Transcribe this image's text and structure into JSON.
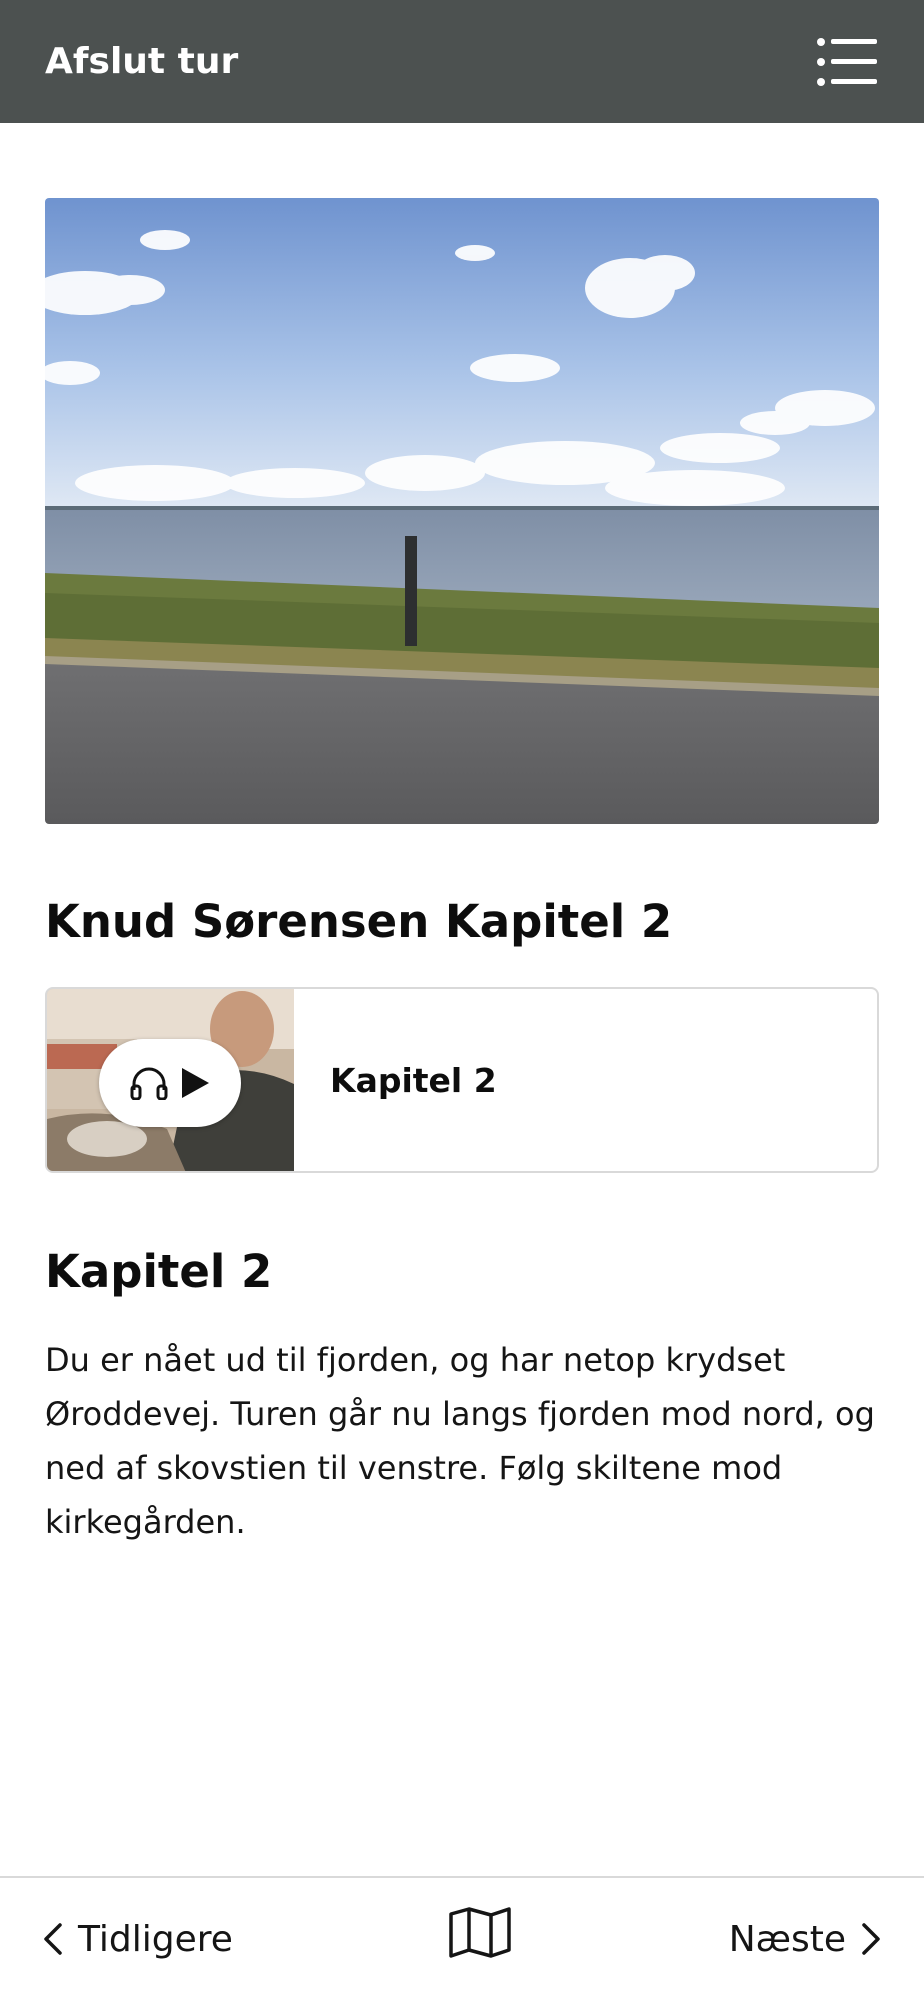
{
  "header": {
    "title": "Afslut tur",
    "menu_icon": "list-menu-icon"
  },
  "hero": {
    "icon": "fjord-landscape-photo"
  },
  "tour": {
    "title": "Knud Sørensen Kapitel 2"
  },
  "audio_card": {
    "label": "Kapitel 2",
    "headphones_icon": "headphones-icon",
    "play_icon": "play-icon"
  },
  "chapter": {
    "title": "Kapitel 2",
    "body": "Du er nået ud til fjorden, og har netop krydset Øroddevej. Turen går nu langs fjorden mod nord, og ned af skovstien til venstre. Følg skiltene mod kirkegården."
  },
  "footer": {
    "previous_label": "Tidligere",
    "next_label": "Næste",
    "map_icon": "map-icon"
  },
  "colors": {
    "header_bg": "#4c5150",
    "text": "#111111",
    "border": "#d9d9d9"
  }
}
